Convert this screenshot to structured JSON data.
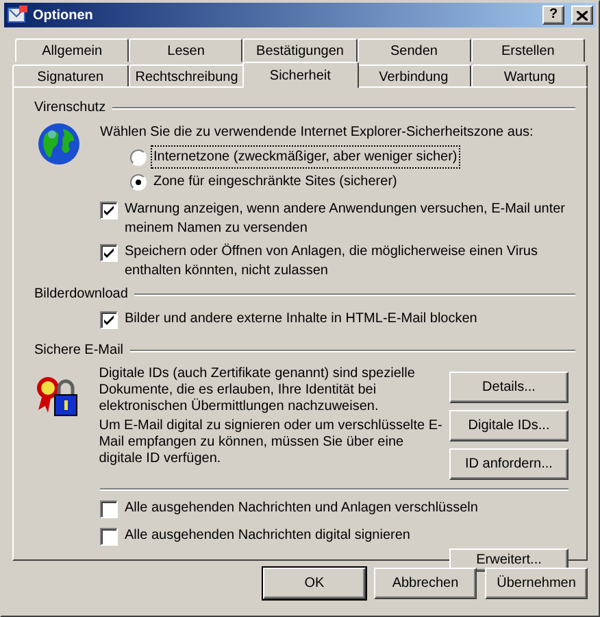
{
  "window": {
    "title": "Optionen",
    "help_button": "?"
  },
  "tab_rows": [
    [
      {
        "label": "Allgemein",
        "selected": false
      },
      {
        "label": "Lesen",
        "selected": false
      },
      {
        "label": "Bestätigungen",
        "selected": false
      },
      {
        "label": "Senden",
        "selected": false
      },
      {
        "label": "Erstellen",
        "selected": false
      }
    ],
    [
      {
        "label": "Signaturen",
        "selected": false
      },
      {
        "label": "Rechtschreibung",
        "selected": false
      },
      {
        "label": "Sicherheit",
        "selected": true
      },
      {
        "label": "Verbindung",
        "selected": false
      },
      {
        "label": "Wartung",
        "selected": false
      }
    ]
  ],
  "virus_protection": {
    "heading": "Virenschutz",
    "zone_prompt": "Wählen Sie die zu verwendende Internet Explorer-Sicherheitszone aus:",
    "zones": [
      {
        "label": "Internetzone (zweckmäßiger, aber weniger sicher)",
        "selected": false,
        "focused": true
      },
      {
        "label": "Zone für eingeschränkte Sites (sicherer)",
        "selected": true,
        "focused": false
      }
    ],
    "options": [
      {
        "label": "Warnung anzeigen, wenn andere Anwendungen versuchen, E-Mail unter meinem Namen zu versenden",
        "checked": true
      },
      {
        "label": "Speichern oder Öffnen von Anlagen, die möglicherweise einen Virus enthalten könnten, nicht zulassen",
        "checked": true
      }
    ]
  },
  "image_download": {
    "heading": "Bilderdownload",
    "options": [
      {
        "label": "Bilder und andere externe Inhalte in HTML-E-Mail blocken",
        "checked": true
      }
    ]
  },
  "secure_mail": {
    "heading": "Sichere E-Mail",
    "paragraphs": [
      "Digitale IDs (auch Zertifikate genannt) sind spezielle Dokumente, die es erlauben, Ihre Identität bei elektronischen Übermittlungen nachzuweisen.",
      "Um E-Mail digital zu signieren oder um verschlüsselte E-Mail empfangen zu können, müssen Sie über eine digitale ID verfügen."
    ],
    "buttons": [
      "Details...",
      "Digitale IDs...",
      "ID anfordern..."
    ],
    "options": [
      {
        "label": "Alle ausgehenden Nachrichten und Anlagen verschlüsseln",
        "checked": false
      },
      {
        "label": "Alle ausgehenden Nachrichten digital signieren",
        "checked": false
      }
    ],
    "advanced_button": "Erweitert..."
  },
  "footer_buttons": [
    {
      "label": "OK",
      "default": true
    },
    {
      "label": "Abbrechen",
      "default": false
    },
    {
      "label": "Übernehmen",
      "default": false
    }
  ]
}
